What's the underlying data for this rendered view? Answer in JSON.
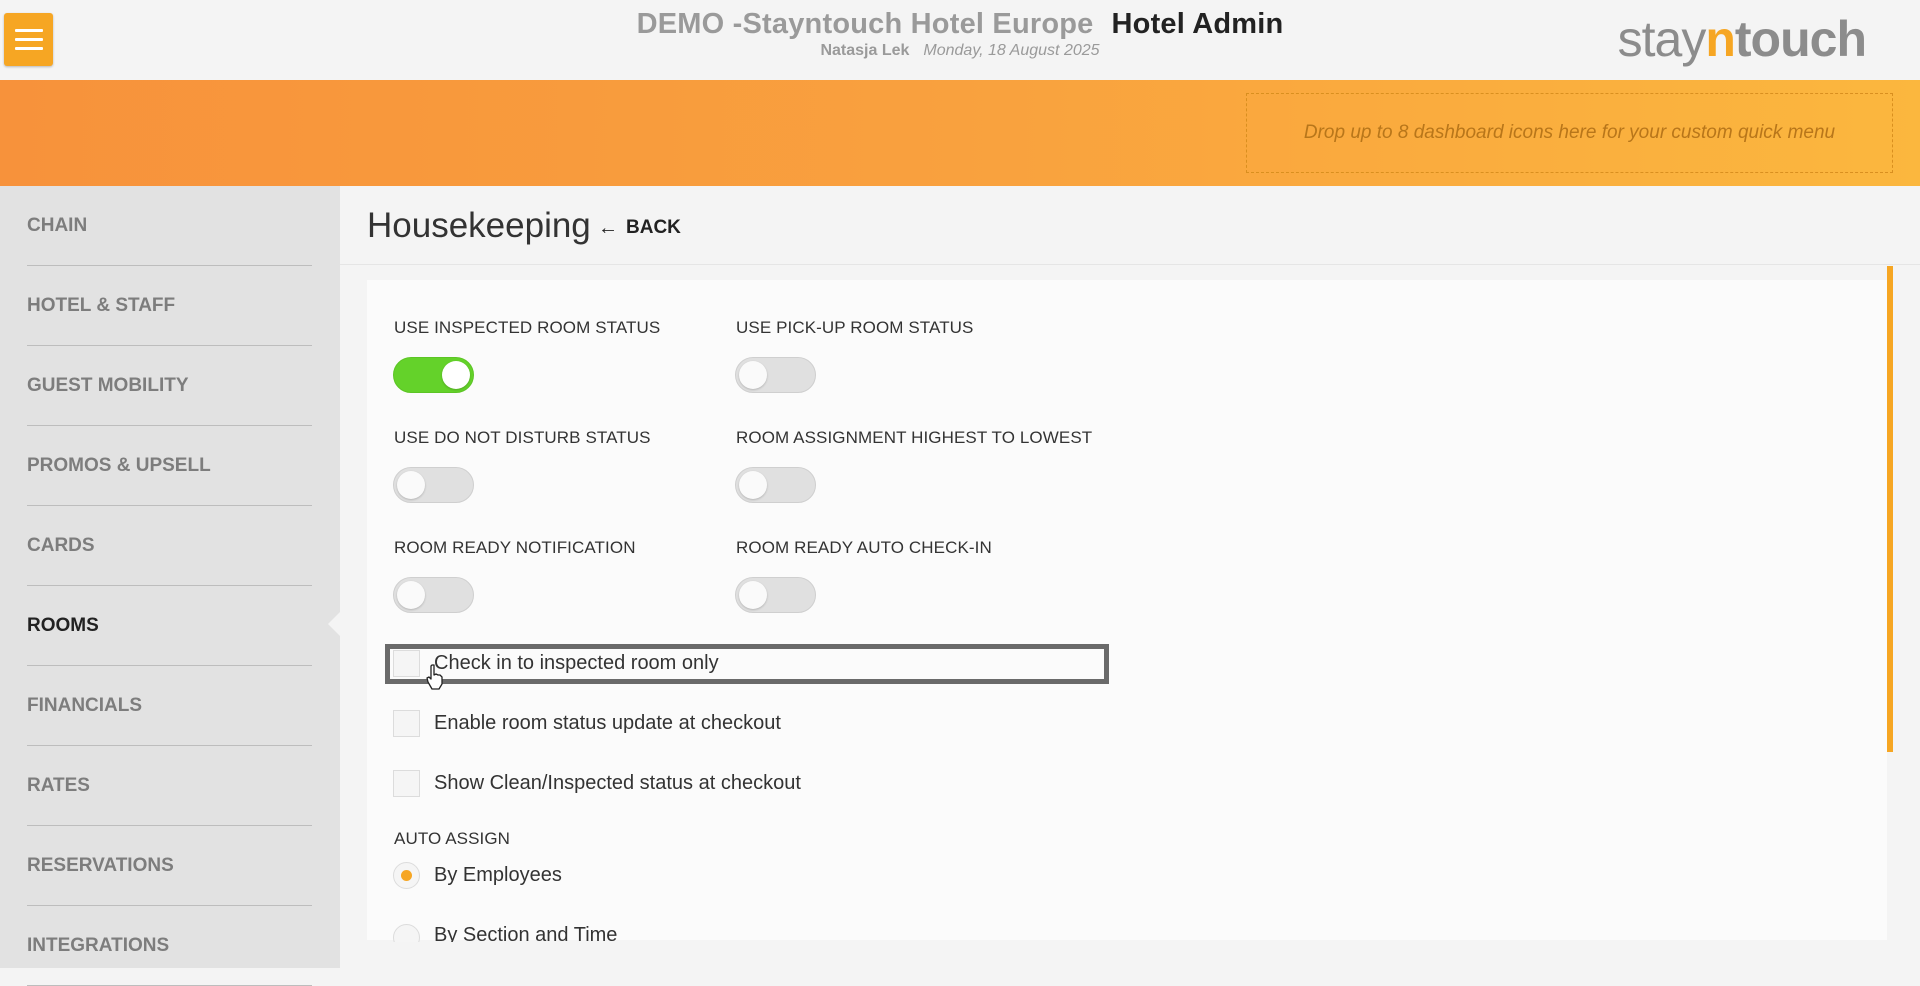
{
  "header": {
    "hotel_name": "DEMO -Stayntouch Hotel Europe",
    "app_name": "Hotel Admin",
    "user": "Natasja Lek",
    "date": "Monday, 18 August 2025",
    "logo": {
      "part1": "stay",
      "part2": "n",
      "part3": "touch"
    }
  },
  "quick_menu": {
    "placeholder": "Drop up to 8 dashboard icons here for your custom quick menu"
  },
  "sidebar": {
    "items": [
      {
        "label": "CHAIN"
      },
      {
        "label": "HOTEL & STAFF"
      },
      {
        "label": "GUEST MOBILITY"
      },
      {
        "label": "PROMOS & UPSELL"
      },
      {
        "label": "CARDS"
      },
      {
        "label": "ROOMS",
        "active": true
      },
      {
        "label": "FINANCIALS"
      },
      {
        "label": "RATES"
      },
      {
        "label": "RESERVATIONS"
      },
      {
        "label": "INTEGRATIONS"
      }
    ]
  },
  "page": {
    "title": "Housekeeping",
    "back_label": "BACK"
  },
  "settings": {
    "toggles": [
      {
        "label": "USE INSPECTED ROOM STATUS",
        "on": true
      },
      {
        "label": "USE PICK-UP ROOM STATUS",
        "on": false
      },
      {
        "label": "USE DO NOT DISTURB STATUS",
        "on": false
      },
      {
        "label": "ROOM ASSIGNMENT HIGHEST TO LOWEST",
        "on": false
      },
      {
        "label": "ROOM READY NOTIFICATION",
        "on": false
      },
      {
        "label": "ROOM READY AUTO CHECK-IN",
        "on": false
      }
    ],
    "checkboxes": [
      {
        "label": "Check in to inspected room only",
        "checked": false
      },
      {
        "label": "Enable room status update at checkout",
        "checked": false
      },
      {
        "label": "Show Clean/Inspected status at checkout",
        "checked": false
      }
    ],
    "auto_assign": {
      "label": "AUTO ASSIGN",
      "options": [
        {
          "label": "By Employees",
          "selected": true
        },
        {
          "label": "By Section and Time",
          "selected": false
        }
      ]
    }
  },
  "colors": {
    "accent": "#f6a623",
    "toggle_on": "#64d22a"
  }
}
